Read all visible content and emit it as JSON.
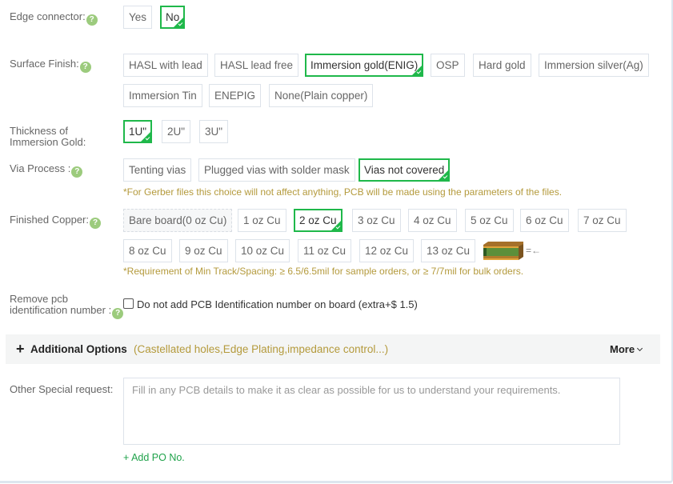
{
  "colors": {
    "accent_green": "#1fb84a",
    "note_gold": "#b49a3c",
    "help_icon": "#9ccb7d"
  },
  "edge_connector": {
    "label": "Edge connector:",
    "options": [
      {
        "label": "Yes",
        "selected": false
      },
      {
        "label": "No",
        "selected": true
      }
    ]
  },
  "surface_finish": {
    "label": "Surface Finish:",
    "options": [
      {
        "label": "HASL with lead",
        "selected": false
      },
      {
        "label": "HASL lead free",
        "selected": false
      },
      {
        "label": "Immersion gold(ENIG)",
        "selected": true
      },
      {
        "label": "OSP",
        "selected": false
      },
      {
        "label": "Hard gold",
        "selected": false
      },
      {
        "label": "Immersion silver(Ag)",
        "selected": false
      },
      {
        "label": "Immersion Tin",
        "selected": false
      },
      {
        "label": "ENEPIG",
        "selected": false
      },
      {
        "label": "None(Plain copper)",
        "selected": false
      }
    ]
  },
  "gold_thickness": {
    "label_line1": "Thickness of",
    "label_line2": "Immersion Gold:",
    "options": [
      {
        "label": "1U\"",
        "selected": true
      },
      {
        "label": "2U\"",
        "selected": false
      },
      {
        "label": "3U\"",
        "selected": false
      }
    ]
  },
  "via_process": {
    "label": "Via Process :",
    "options": [
      {
        "label": "Tenting vias",
        "selected": false
      },
      {
        "label": "Plugged vias with solder mask",
        "selected": false
      },
      {
        "label": "Vias not covered",
        "selected": true
      }
    ],
    "note": "*For Gerber files this choice will not affect anything, PCB will be made using the parameters of the files."
  },
  "finished_copper": {
    "label": "Finished Copper:",
    "options": [
      {
        "label": "Bare board(0 oz Cu)",
        "selected": false,
        "disabled": true
      },
      {
        "label": "1 oz Cu",
        "selected": false
      },
      {
        "label": "2 oz Cu",
        "selected": true
      },
      {
        "label": "3 oz Cu",
        "selected": false
      },
      {
        "label": "4 oz Cu",
        "selected": false
      },
      {
        "label": "5 oz Cu",
        "selected": false
      },
      {
        "label": "6 oz Cu",
        "selected": false
      },
      {
        "label": "7 oz Cu",
        "selected": false
      },
      {
        "label": "8 oz Cu",
        "selected": false
      },
      {
        "label": "9 oz Cu",
        "selected": false
      },
      {
        "label": "10 oz Cu",
        "selected": false
      },
      {
        "label": "11 oz Cu",
        "selected": false
      },
      {
        "label": "12 oz Cu",
        "selected": false
      },
      {
        "label": "13 oz Cu",
        "selected": false
      }
    ],
    "diagram_arrow": "=←",
    "note": "*Requirement of Min Track/Spacing: ≥ 6.5/6.5mil for sample orders, or ≥ 7/7mil for bulk orders."
  },
  "remove_id": {
    "label_line1": "Remove pcb",
    "label_line2": "identification number :",
    "checkbox_label": "Do not add PCB Identification number on board (extra+$ 1.5)",
    "checked": false
  },
  "additional_options": {
    "plus": "+",
    "title": "Additional Options",
    "subtitle": "(Castellated holes,Edge Plating,impedance control...)",
    "more": "More"
  },
  "special_request": {
    "label": "Other Special request:",
    "value": "",
    "placeholder": "Fill in any PCB details to make it as clear as possible for us to understand your requirements."
  },
  "add_po": "+ Add PO No.",
  "help_glyph": "?"
}
